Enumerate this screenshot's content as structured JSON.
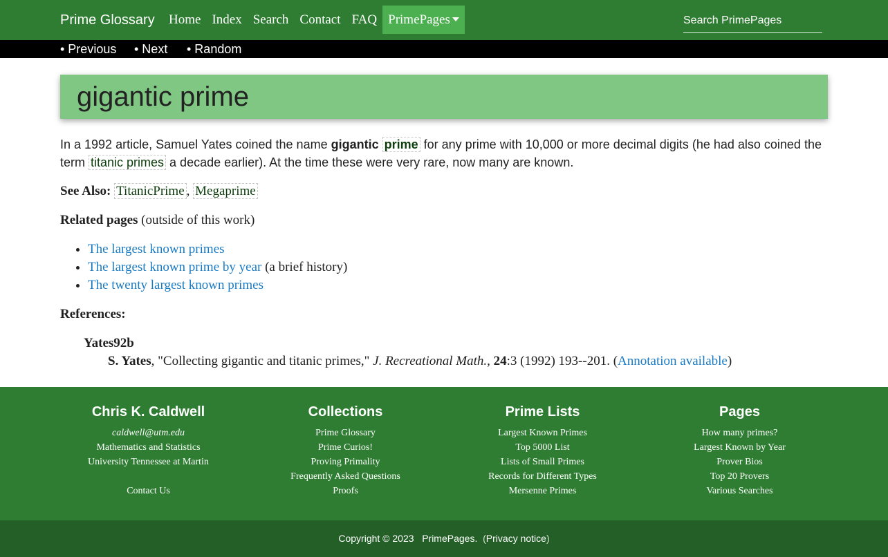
{
  "nav": {
    "brand": "Prime Glossary",
    "links": [
      "Home",
      "Index",
      "Search",
      "Contact",
      "FAQ"
    ],
    "dropdown_label": "PrimePages",
    "search_placeholder": "Search PrimePages"
  },
  "subnav": {
    "previous": "• Previous",
    "next": "• Next",
    "random": "• Random"
  },
  "page": {
    "title": "gigantic prime",
    "intro": {
      "t1": "In a 1992 article, Samuel Yates coined the name ",
      "bold": "gigantic",
      "link_prime": "prime",
      "t2": " for any prime with 10,000 or more decimal digits (he had also coined the term ",
      "link_titanic": "titanic primes",
      "t3": " a decade earlier).  At the time these were very rare, now many are known."
    },
    "see_also": {
      "label": "See Also:",
      "links": [
        "TitanicPrime",
        "Megaprime"
      ],
      "sep": ","
    },
    "related": {
      "label": "Related pages",
      "note": " (outside of this work)",
      "items": [
        {
          "text": "The largest known primes",
          "suffix": ""
        },
        {
          "text": "The largest known prime by year",
          "suffix": " (a brief history)"
        },
        {
          "text": "The twenty largest known primes",
          "suffix": ""
        }
      ]
    },
    "references": {
      "label": "References:",
      "key": "Yates92b",
      "author": "S. Yates",
      "title_part": ", \"Collecting gigantic and titanic primes,\" ",
      "journal": "J. Recreational Math.",
      "comma": ", ",
      "volume": "24",
      "details": ":3 (1992) 193--201. (",
      "annotation": "Annotation available",
      "close": ")"
    }
  },
  "footer": {
    "col1": {
      "heading": "Chris K. Caldwell",
      "email": "caldwell@utm.edu",
      "dept": "Mathematics and Statistics",
      "univ": "University Tennessee at Martin",
      "contact": "Contact Us"
    },
    "col2": {
      "heading": "Collections",
      "items": [
        "Prime Glossary",
        "Prime Curios!",
        "Proving Primality",
        "Frequently Asked Questions",
        "Proofs"
      ]
    },
    "col3": {
      "heading": "Prime Lists",
      "items": [
        "Largest Known Primes",
        "Top 5000 List",
        "Lists of Small Primes",
        "Records for Different Types",
        "Mersenne Primes"
      ]
    },
    "col4": {
      "heading": "Pages",
      "items": [
        "How many primes?",
        "Largest Known by Year",
        "Prover Bios",
        "Top 20 Provers",
        "Various Searches"
      ]
    }
  },
  "copyright": {
    "text": "Copyright © 2023",
    "site": "PrimePages",
    "dot": ".",
    "open": "(",
    "privacy": "Privacy notice",
    "close": ")"
  },
  "colors": {
    "nav_green": "#2e7d32",
    "active_tab": "#4caf50",
    "title_card": "#81c784",
    "link_blue": "#1a7ac2",
    "copyright_bar": "#235f27"
  }
}
